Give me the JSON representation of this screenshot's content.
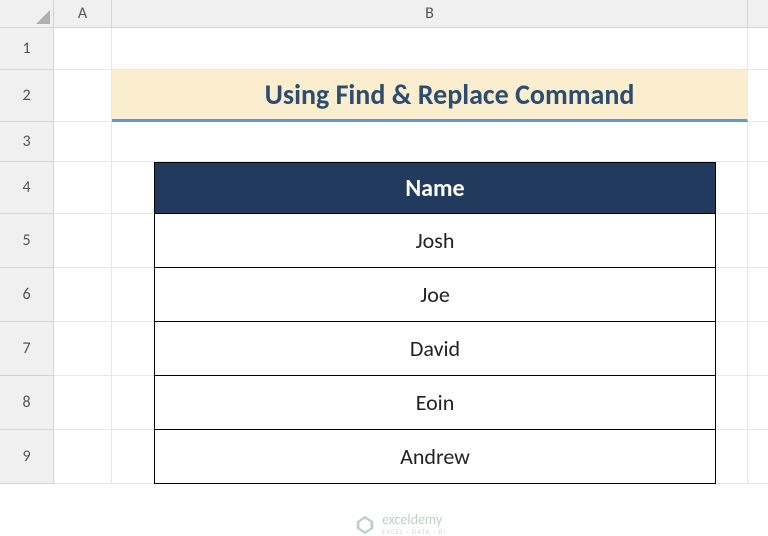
{
  "columns": {
    "a": "A",
    "b": "B"
  },
  "rows": [
    "1",
    "2",
    "3",
    "4",
    "5",
    "6",
    "7",
    "8",
    "9"
  ],
  "title": "Using Find & Replace Command",
  "table": {
    "header": "Name",
    "data": [
      "Josh",
      "Joe",
      "David",
      "Eoin",
      "Andrew"
    ]
  },
  "watermark": {
    "main": "exceldemy",
    "sub": "EXCEL · DATA · BI"
  }
}
